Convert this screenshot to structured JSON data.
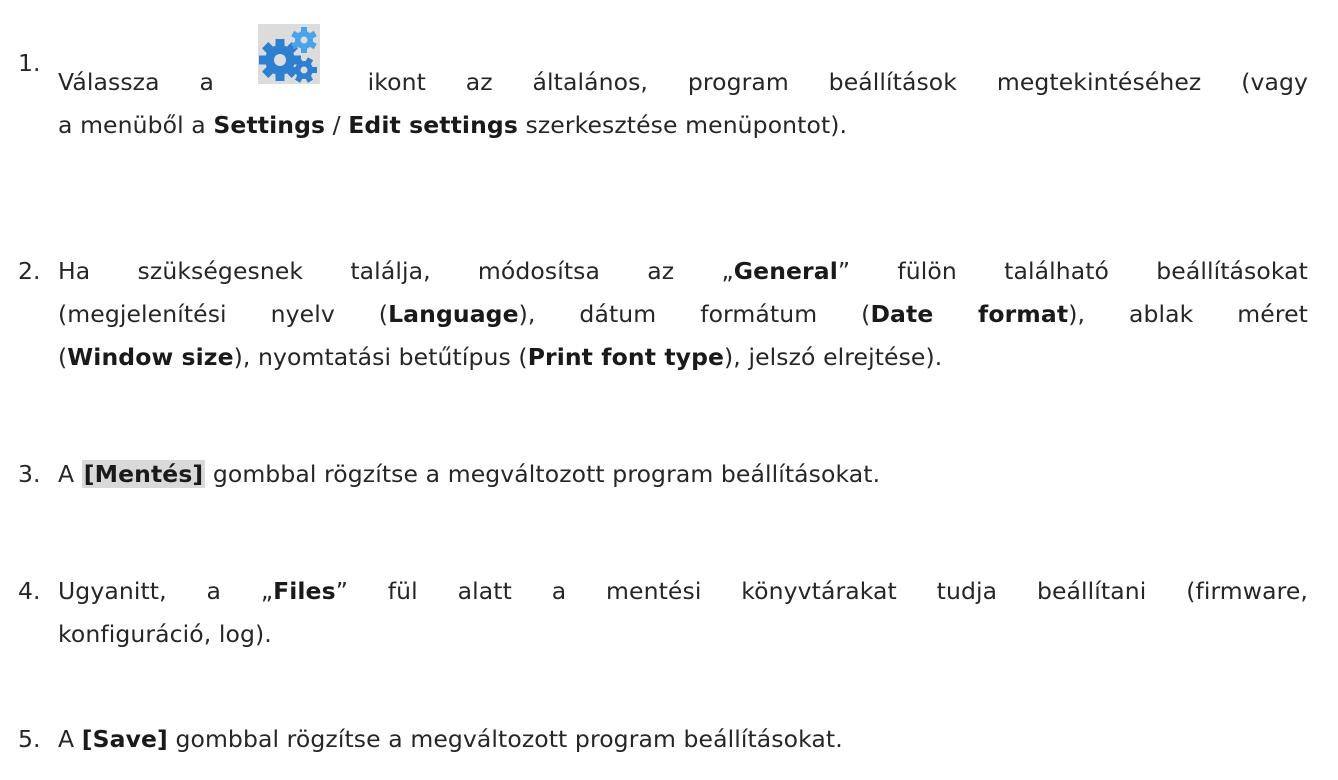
{
  "steps": [
    {
      "number": "1.",
      "line1_before_icon": "Válassza a ",
      "line1_after_icon": " ikont az általános, program beállítások megtekintéséhez (vagy",
      "line2_a": "a menüből a ",
      "line2_b": "Settings",
      "line2_c": " / ",
      "line2_d": "Edit settings",
      "line2_e": " szerkesztése menüpontot)."
    },
    {
      "number": "2.",
      "l1_a": "Ha szükségesnek találja, módosítsa az „",
      "l1_b": "General",
      "l1_c": "” fülön található beállításokat",
      "l2_a": "(megjelenítési nyelv (",
      "l2_b": "Language",
      "l2_c": "), dátum formátum (",
      "l2_d": "Date format",
      "l2_e": "), ablak méret",
      "l3_a": "(",
      "l3_b": "Window size",
      "l3_c": "), nyomtatási betűtípus (",
      "l3_d": "Print font type",
      "l3_e": "), jelszó elrejtése)."
    },
    {
      "number": "3.",
      "a": "A ",
      "button": "[Mentés]",
      "b": " gombbal rögzítse a megváltozott program beállításokat."
    },
    {
      "number": "4.",
      "l1_a": "Ugyanitt, a „",
      "l1_b": "Files",
      "l1_c": "” fül alatt a mentési könyvtárakat tudja beállítani (firmware,",
      "l2": "konfiguráció, log)."
    },
    {
      "number": "5.",
      "a": "A ",
      "button": "[Save]",
      "b": " gombbal rögzítse a megváltozott program beállításokat."
    }
  ],
  "icon": "gears-settings-icon",
  "colors": {
    "text": "#262626",
    "highlight": "#d9d9d9",
    "gear_large": "#2f7fd0",
    "gear_small": "#4aa3e8"
  }
}
